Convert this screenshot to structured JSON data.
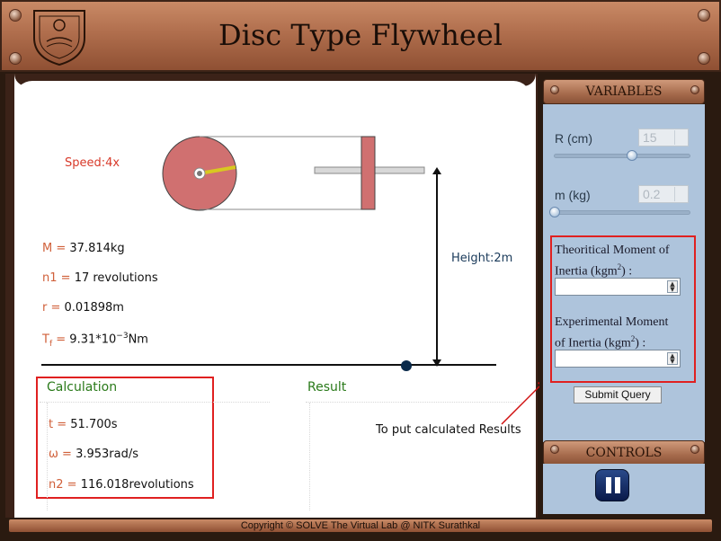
{
  "header": {
    "title": "Disc Type Flywheel",
    "logo_icon": "institute-emblem-icon"
  },
  "simulation": {
    "speed_label": "Speed:4x",
    "height_label": "Height:2m",
    "params": [
      {
        "name": "M",
        "value": "37.814kg"
      },
      {
        "name": "n1",
        "value": "17 revolutions"
      },
      {
        "name": "r",
        "value": "0.01898m"
      }
    ],
    "tf": {
      "name": "T",
      "sub": "f",
      "value_prefix": "9.31*10",
      "value_sup": "−3",
      "value_suffix": "Nm"
    }
  },
  "calculation": {
    "title": "Calculation",
    "items": [
      {
        "name": "t",
        "value": "51.700s"
      },
      {
        "name": "ω",
        "value": "3.953rad/s"
      },
      {
        "name": "n2",
        "value": "116.018revolutions"
      }
    ]
  },
  "result": {
    "title": "Result",
    "annotation": "To put calculated Results"
  },
  "variables": {
    "header": "VARIABLES",
    "r_label": "R (cm)",
    "r_value": "15",
    "r_level": 0.68,
    "m_label": "m (kg)",
    "m_value": "0.2",
    "m_level": 0.0
  },
  "moi": {
    "theoretical_label_1": "Theoritical Moment of",
    "theoretical_label_2": "Inertia (kgm",
    "theoretical_label_sup": "2",
    "theoretical_label_end": ") :",
    "experimental_label_1": "Experimental Moment",
    "experimental_label_2": "of Inertia (kgm",
    "experimental_label_sup": "2",
    "experimental_label_end": ") :",
    "theoretical_value": "",
    "experimental_value": ""
  },
  "submit_label": "Submit Query",
  "controls": {
    "header": "CONTROLS",
    "pause_icon": "pause-icon"
  },
  "footer": {
    "copyright": "Copyright © SOLVE The Virtual Lab @ NITK Surathkal"
  },
  "colors": {
    "accent_red": "#e02020",
    "copper": "#b06e4d",
    "panel_blue": "#aec4dc",
    "disc": "#d07070"
  }
}
